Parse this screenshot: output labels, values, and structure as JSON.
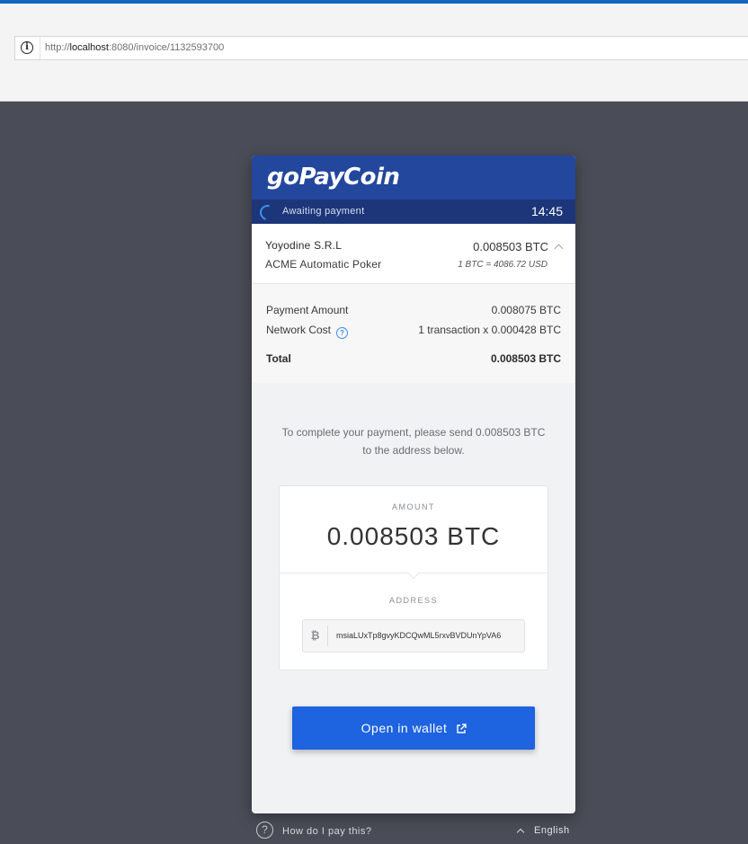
{
  "browser": {
    "url_prefix": "http://",
    "url_host": "localhost",
    "url_rest": ":8080/invoice/1132593700"
  },
  "header": {
    "brand": "goPayCoin",
    "status": "Awaiting payment",
    "timer": "14:45"
  },
  "merchant": {
    "name": "Yoyodine S.R.L",
    "item": "ACME Automatic Poker",
    "total": "0.008503 BTC",
    "rate": "1 BTC = 4086.72 USD"
  },
  "breakdown": {
    "payment_amount_label": "Payment Amount",
    "payment_amount_value": "0.008075 BTC",
    "network_cost_label": "Network Cost",
    "network_cost_value": "1 transaction x 0.000428 BTC",
    "total_label": "Total",
    "total_value": "0.008503 BTC"
  },
  "instructions": "To complete your payment, please send 0.008503 BTC to the address below.",
  "payment": {
    "amount_label": "AMOUNT",
    "amount": "0.008503 BTC",
    "address_label": "ADDRESS",
    "address": "msiaLUxTp8gvyKDCQwML5rxvBVDUnYpVA6",
    "currency_symbol": "₿"
  },
  "wallet_button": "Open in wallet",
  "footer": {
    "help": "How do I pay this?",
    "language": "English"
  },
  "colors": {
    "brand_blue": "#24479e",
    "status_bar": "#1d3679",
    "button_blue": "#1e63e0",
    "backdrop": "#4a4d57"
  }
}
